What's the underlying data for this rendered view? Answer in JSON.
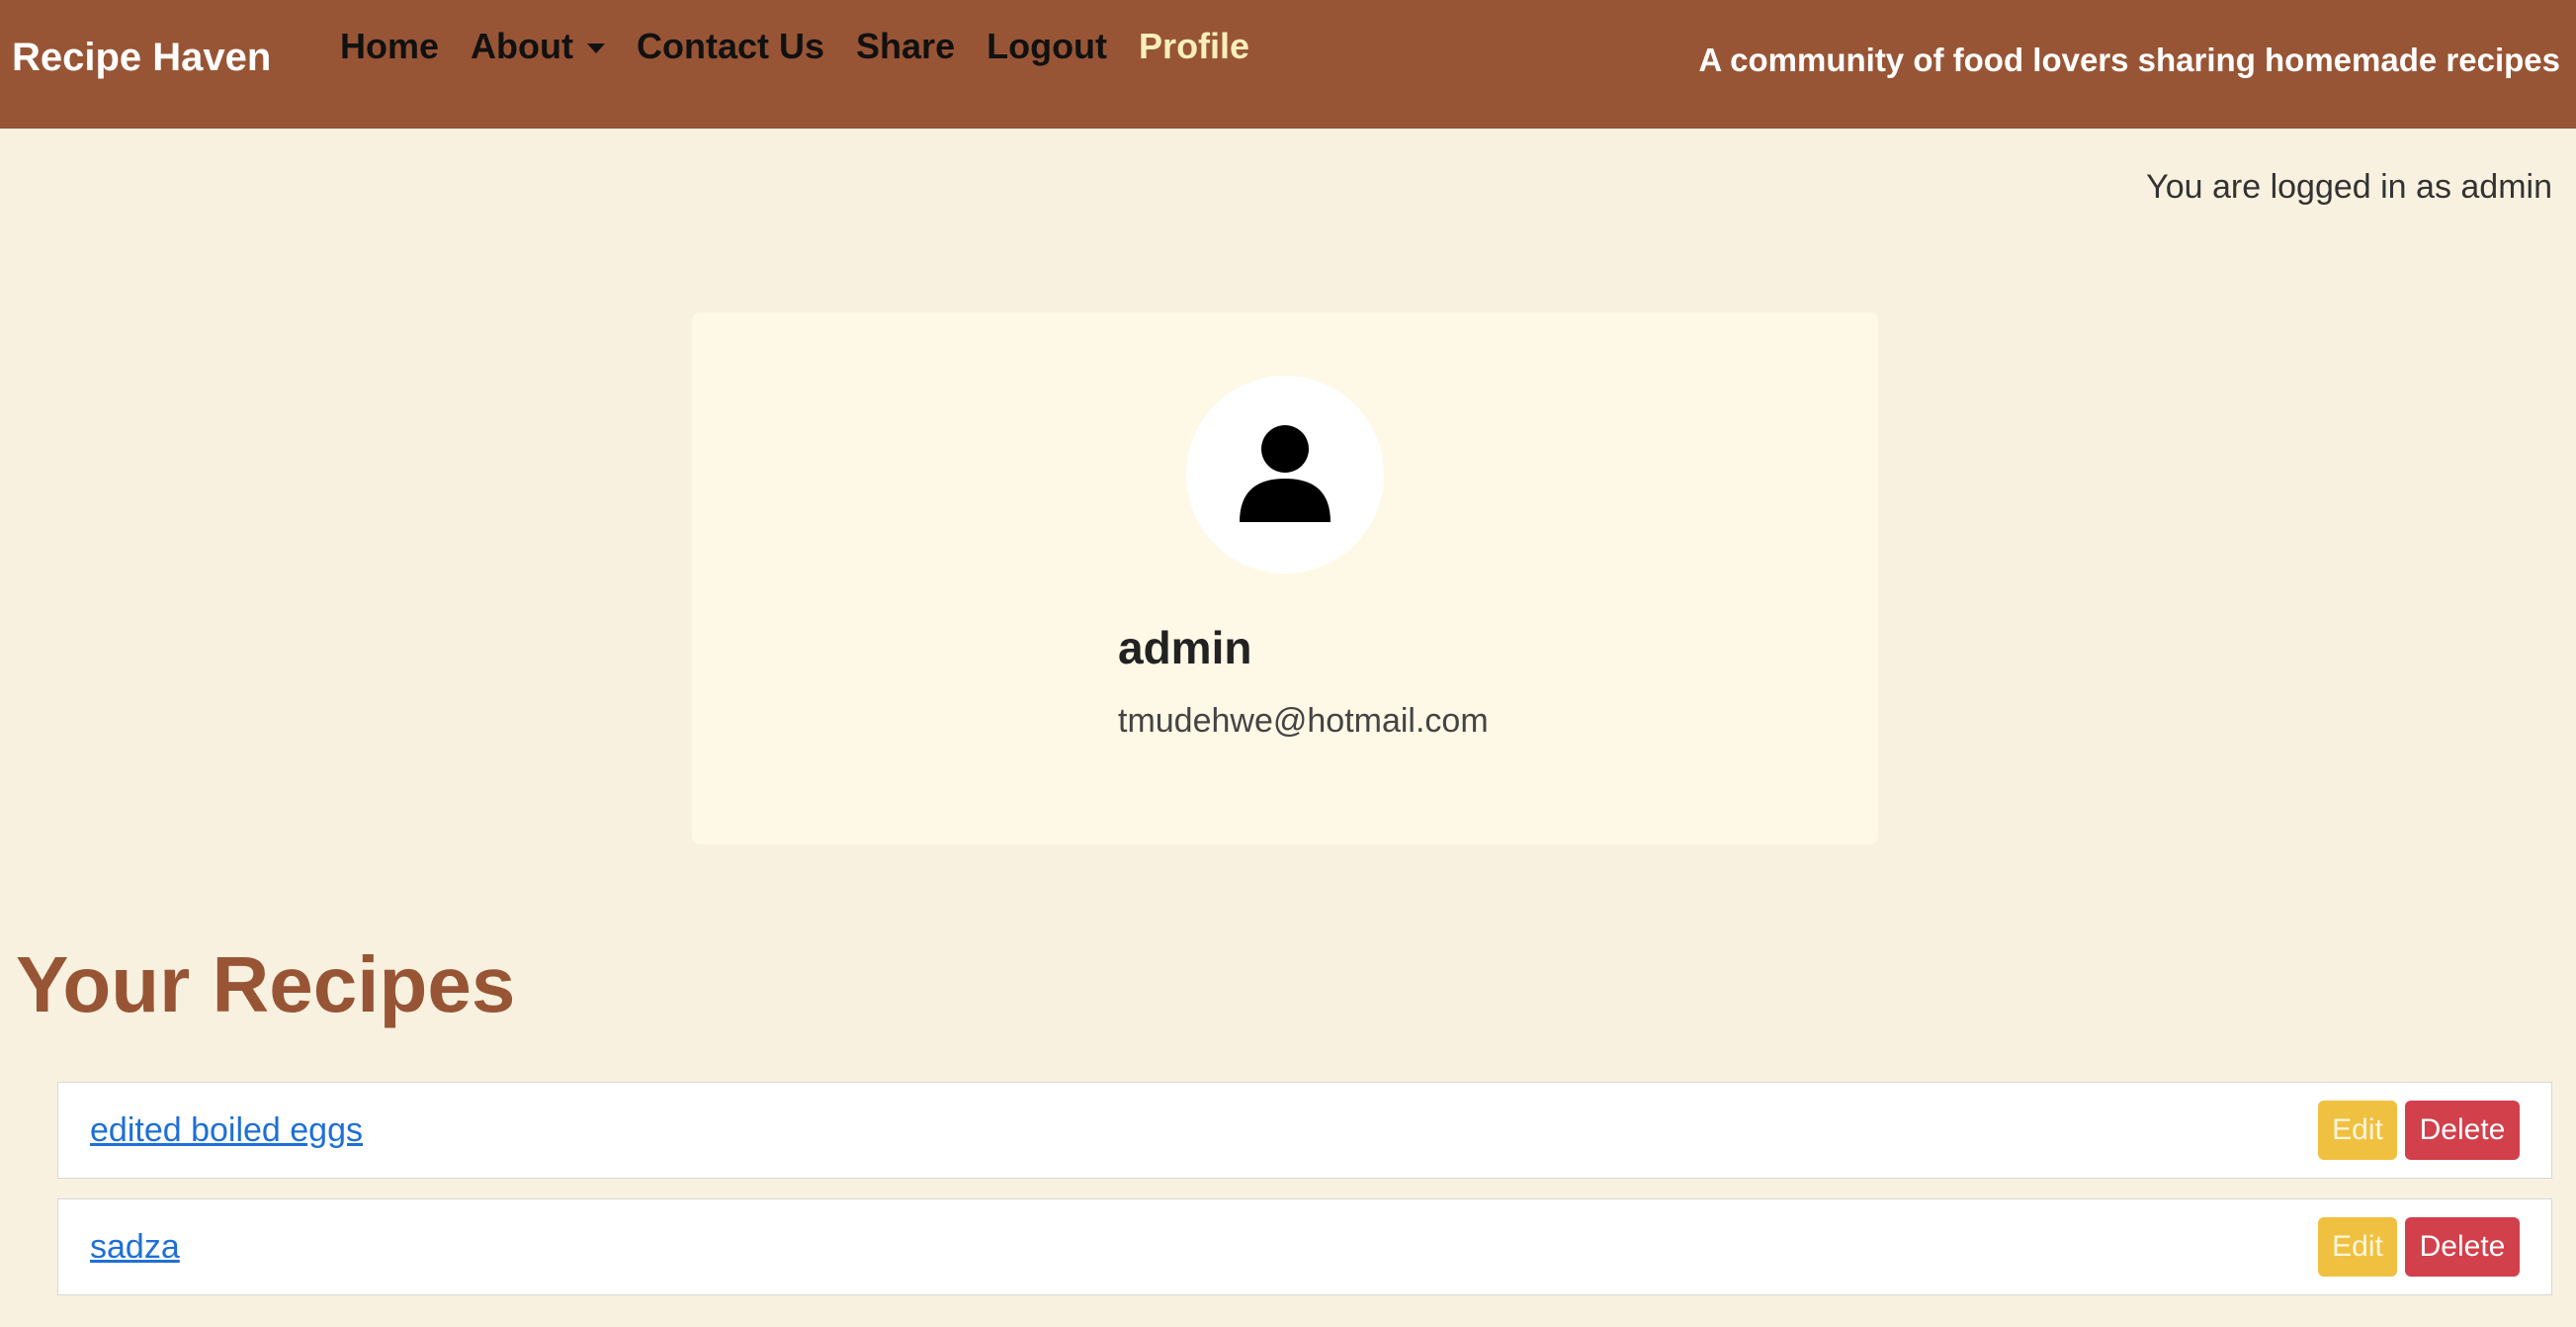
{
  "navbar": {
    "brand": "Recipe Haven",
    "links": [
      {
        "label": "Home"
      },
      {
        "label": "About",
        "dropdown": true
      },
      {
        "label": "Contact Us"
      },
      {
        "label": "Share"
      },
      {
        "label": "Logout"
      },
      {
        "label": "Profile",
        "active": true
      }
    ],
    "tagline": "A community of food lovers sharing homemade recipes"
  },
  "login_status": "You are logged in as admin",
  "profile": {
    "avatar_icon": "user-icon",
    "name": "admin",
    "email": "tmudehwe@hotmail.com"
  },
  "recipes": {
    "title": "Your Recipes",
    "items": [
      {
        "name": "edited boiled eggs",
        "edit_label": "Edit",
        "delete_label": "Delete"
      },
      {
        "name": "sadza",
        "edit_label": "Edit",
        "delete_label": "Delete"
      }
    ]
  },
  "colors": {
    "navbar": "#985535",
    "page_background": "#f8f1df",
    "card_background": "#fef8e6",
    "accent_title": "#985535",
    "active_nav": "#fbeebd",
    "edit_button": "#f0c040",
    "delete_button": "#d2404b",
    "link": "#1f6fd6"
  }
}
